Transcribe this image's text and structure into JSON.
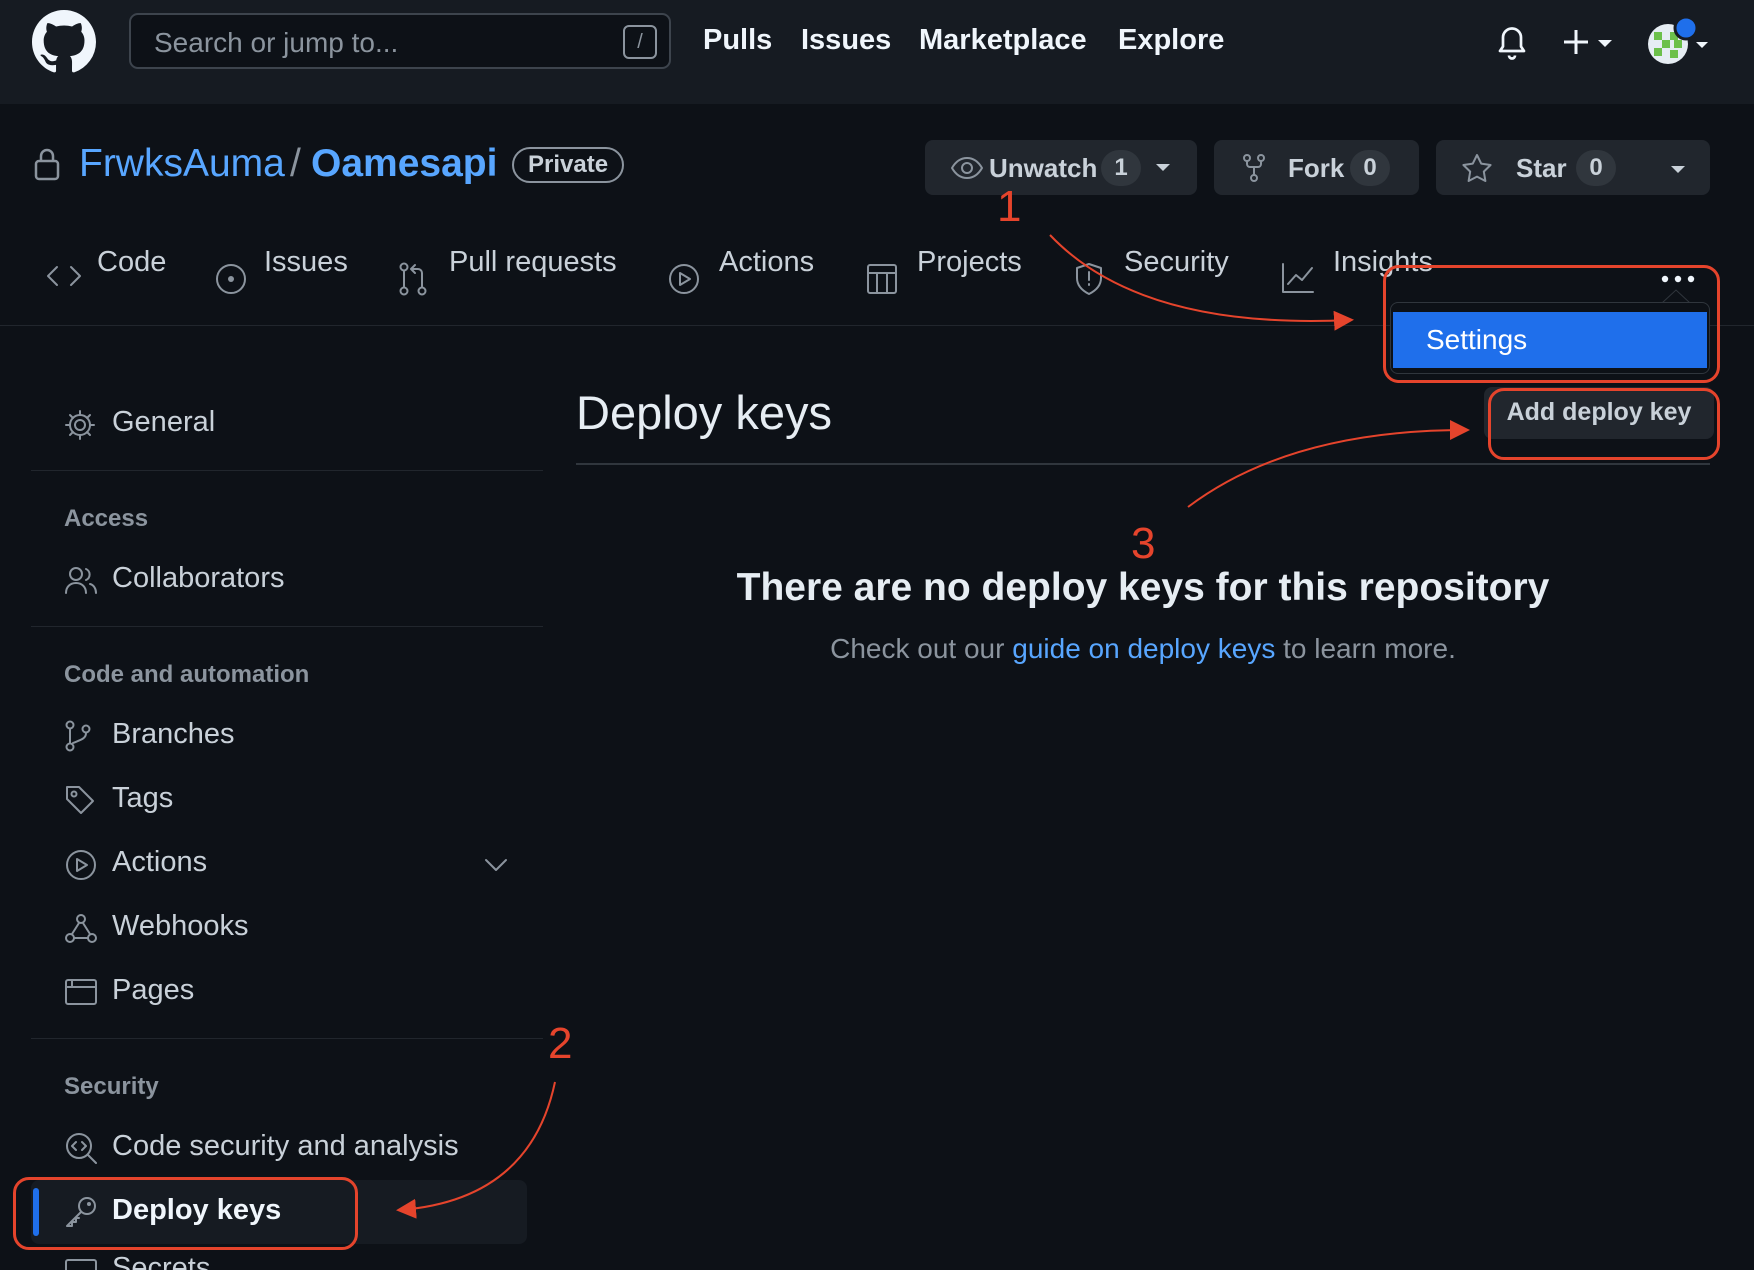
{
  "header": {
    "search_placeholder": "Search or jump to...",
    "search_shortcut": "/",
    "nav": [
      "Pulls",
      "Issues",
      "Marketplace",
      "Explore"
    ],
    "plus_icon": "plus-icon",
    "bell_icon": "bell-icon"
  },
  "repo": {
    "owner": "FrwksAuma",
    "separator": "/",
    "name": "Oamesapi",
    "visibility": "Private",
    "unwatch_label": "Unwatch",
    "unwatch_count": "1",
    "fork_label": "Fork",
    "fork_count": "0",
    "star_label": "Star",
    "star_count": "0"
  },
  "tabs": [
    "Code",
    "Issues",
    "Pull requests",
    "Actions",
    "Projects",
    "Security",
    "Insights"
  ],
  "dropdown": {
    "settings_label": "Settings"
  },
  "sidebar": {
    "general": "General",
    "access_heading": "Access",
    "collaborators": "Collaborators",
    "code_heading": "Code and automation",
    "branches": "Branches",
    "tags": "Tags",
    "actions": "Actions",
    "webhooks": "Webhooks",
    "pages": "Pages",
    "security_heading": "Security",
    "code_security": "Code security and analysis",
    "deploy_keys": "Deploy keys",
    "secrets_partial": "Secrets"
  },
  "main": {
    "title": "Deploy keys",
    "add_button": "Add deploy key",
    "blank_title": "There are no deploy keys for this repository",
    "blank_prefix": "Check out our ",
    "blank_link": "guide on deploy keys",
    "blank_suffix": " to learn more."
  },
  "annotations": {
    "step1": "1",
    "step2": "2",
    "step3": "3",
    "color": "#e5442c"
  },
  "colors": {
    "accent": "#58a6ff",
    "selected": "#1f6feb",
    "background": "#0d1117"
  }
}
